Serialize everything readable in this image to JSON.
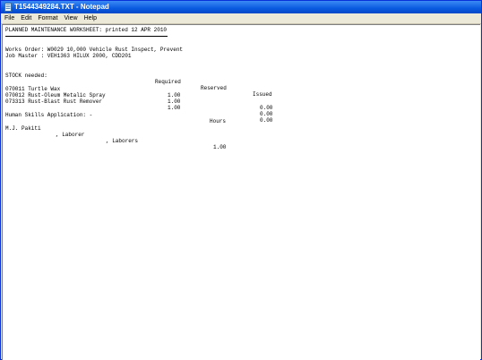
{
  "window": {
    "title": "T1544349284.TXT - Notepad"
  },
  "menu": [
    "File",
    "Edit",
    "Format",
    "View",
    "Help"
  ],
  "document": {
    "heading": "PLANNED MAINTENANCE WORKSHEET: printed 12 APR 2010",
    "works_order": "Works Order: W0029 10,000 Vehicle Rust Inspect, Prevent",
    "job_master": "Job Master : VEH1363 HILUX 2000, CDD201",
    "stock": {
      "label": "STOCK needed:",
      "columns": [
        "Required",
        "Reserved",
        "Issued"
      ],
      "rows": [
        {
          "item": "070011 Turtle Wax",
          "required": "1.00",
          "reserved": "",
          "issued": "0.00"
        },
        {
          "item": "070012 Rust-Oleum Metalic Spray",
          "required": "1.00",
          "reserved": "",
          "issued": "0.00"
        },
        {
          "item": "073313 Rust-Blast Rust Remover",
          "required": "1.00",
          "reserved": "",
          "issued": "0.00"
        }
      ]
    },
    "skills": {
      "label": "Human Skills Application: -",
      "column": "Hours",
      "rows": [
        {
          "name": "M.J. Pakiti",
          "role": ", Laborer",
          "group": ", Laborers",
          "hours": "1.00"
        }
      ]
    }
  }
}
